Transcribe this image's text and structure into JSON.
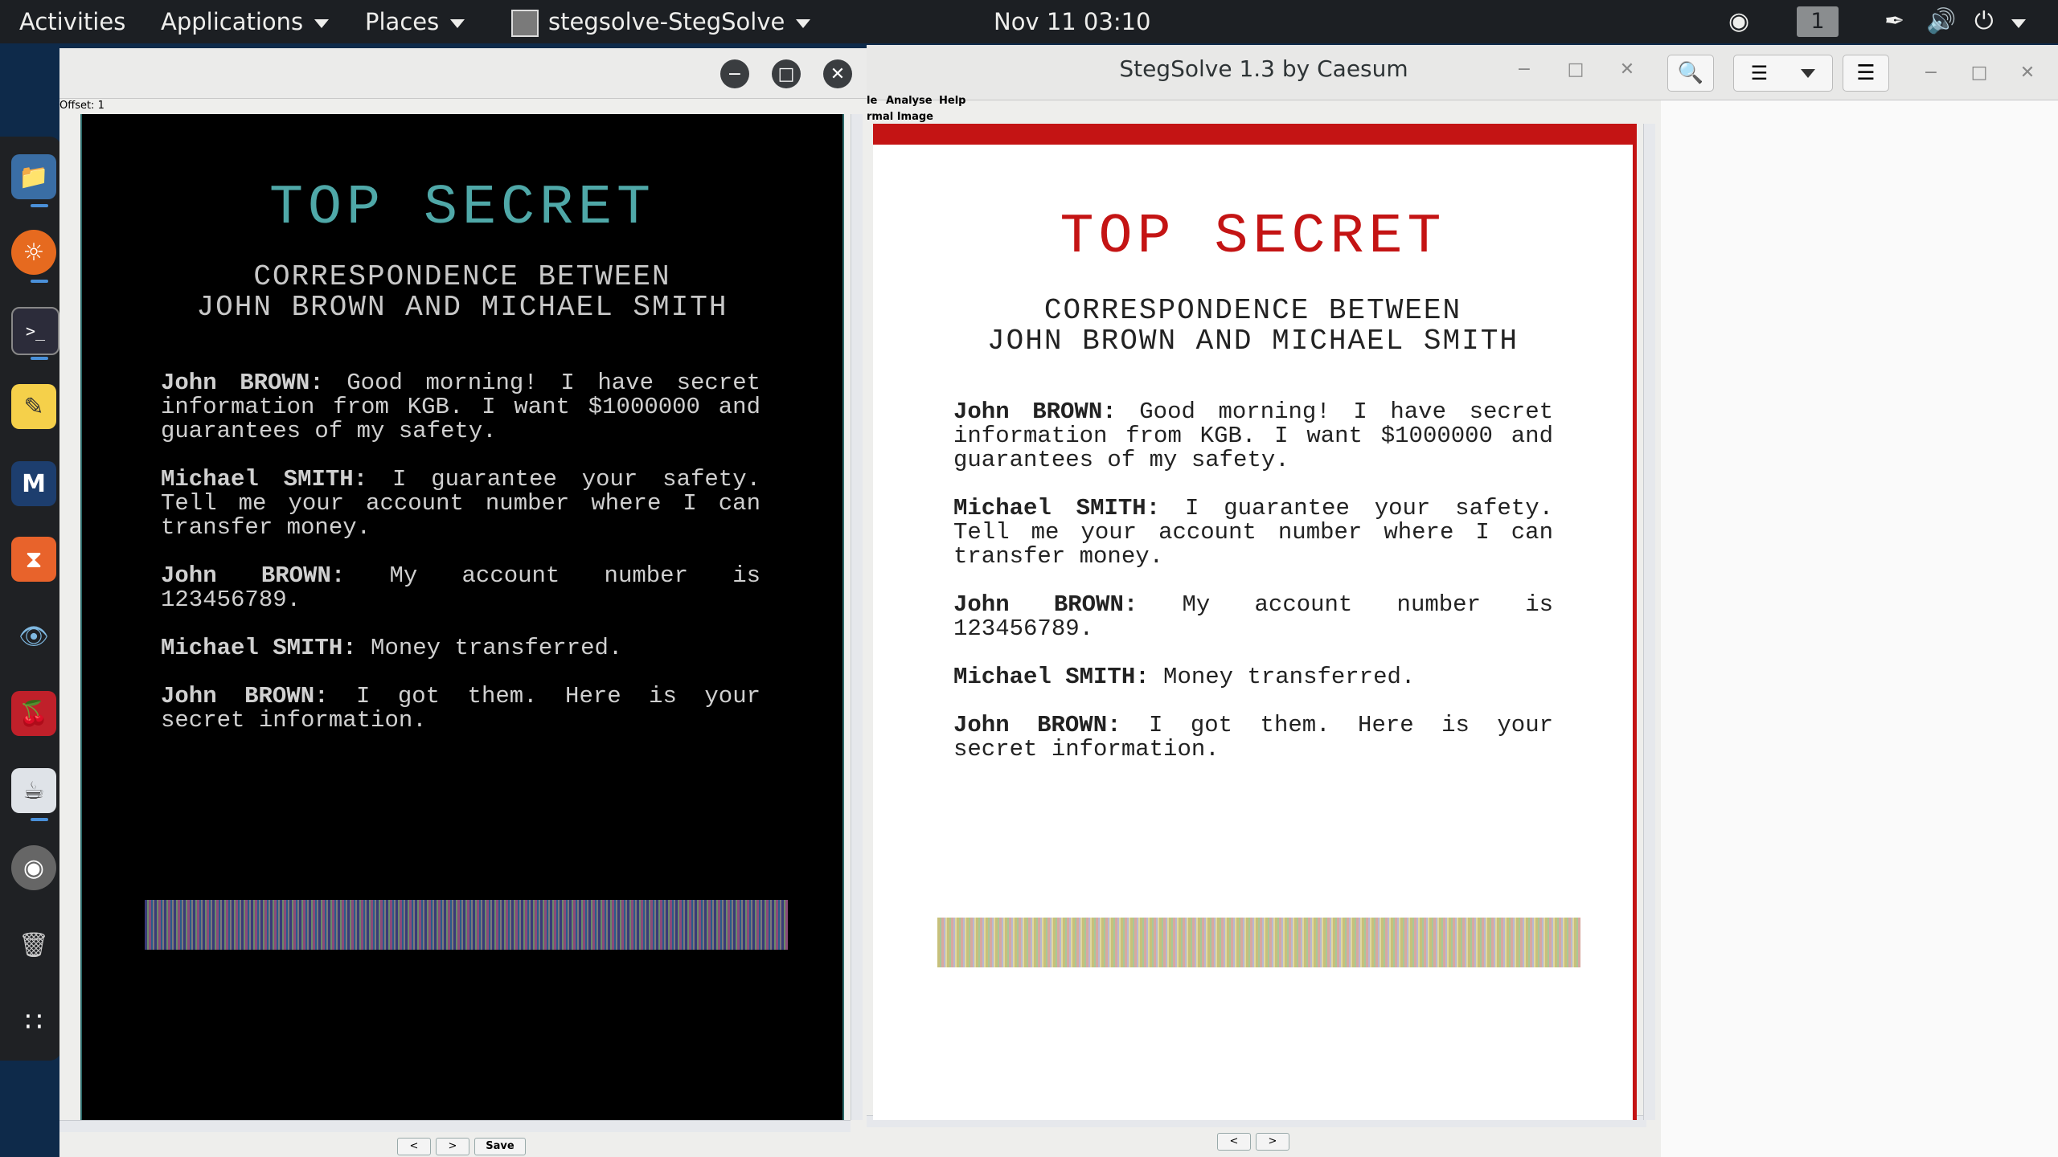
{
  "topbar": {
    "activities": "Activities",
    "applications": "Applications",
    "places": "Places",
    "app_menu": "stegsolve-StegSolve",
    "clock": "Nov 11  03:10",
    "workspace": "1"
  },
  "left_window": {
    "offset_label": "Offset: 1",
    "prev_button": "<",
    "next_button": ">",
    "save_button": "Save"
  },
  "main_window": {
    "title": "StegSolve 1.3 by Caesum",
    "menu": [
      "le",
      "Analyse",
      "Help"
    ],
    "mode_label": "rmal Image",
    "prev_button": "<",
    "next_button": ">"
  },
  "document": {
    "title": "TOP SECRET",
    "subtitle_line1": "CORRESPONDENCE BETWEEN",
    "subtitle_line2": "JOHN BROWN AND MICHAEL SMITH",
    "messages": [
      {
        "speaker": "John BROWN:",
        "text": "Good morning! I have secret information from KGB. I want $1000000 and guarantees of my safety."
      },
      {
        "speaker": "Michael SMITH:",
        "text": "I guarantee your safety. Tell me your account number where I can transfer money."
      },
      {
        "speaker": "John BROWN:",
        "text": "My account number is 123456789."
      },
      {
        "speaker": "Michael SMITH:",
        "text": "Money transferred."
      },
      {
        "speaker": "John BROWN:",
        "text": "I got them. Here is your secret information."
      }
    ]
  },
  "dock": {
    "icons": [
      "files-icon",
      "firefox-icon",
      "terminal-icon",
      "text-editor-icon",
      "metasploit-icon",
      "burpsuite-icon",
      "eye-icon",
      "cherrytree-icon",
      "java-icon",
      "disc-icon",
      "trash-icon",
      "app-grid-icon"
    ]
  },
  "colors": {
    "topbar": "#1c1f23",
    "accent_red": "#c41414",
    "cyan_title": "#4fa8a8"
  }
}
